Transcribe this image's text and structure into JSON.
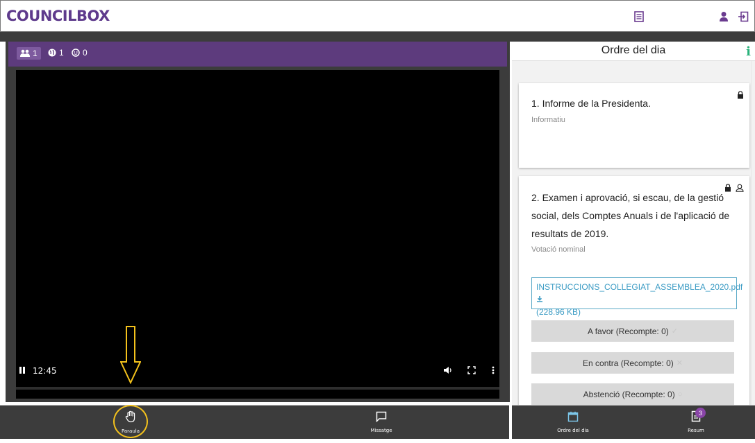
{
  "app": {
    "logo": "COUNCILBOX",
    "icons": [
      "list-icon",
      "user-icon",
      "logout-icon"
    ]
  },
  "video_header": {
    "participants_count": "1",
    "online_count": "1",
    "viewers_count": "0"
  },
  "video": {
    "time": "12:45"
  },
  "agenda": {
    "title": "Ordre del dia",
    "items": [
      {
        "title": "1. Informe de la Presidenta.",
        "type": "Informatiu"
      },
      {
        "title": "2. Examen i aprovació, si escau, de la gestió social, dels Comptes Anuals i de l'aplicació de resultats de 2019.",
        "type": "Votació nominal",
        "attachment_name": "INSTRUCCIONS_COLLEGIAT_ASSEMBLEA_2020.pdf",
        "attachment_size": "(228.96 KB)",
        "votes": [
          {
            "label": "A favor (Recompte: 0)",
            "icon": "check-icon"
          },
          {
            "label": "En contra (Recompte: 0)",
            "icon": "x-icon"
          },
          {
            "label": "Abstenció (Recompte: 0)",
            "icon": "circle-icon"
          }
        ]
      }
    ]
  },
  "bottom_bar": {
    "word_label": "Paraula",
    "message_label": "Missatge",
    "agenda_label": "Ordre del dia",
    "summary_label": "Resum",
    "summary_badge": "3"
  },
  "colors": {
    "brand": "#5e3a8c",
    "video_header": "#5d3b7d",
    "highlight": "#f4c21c",
    "info": "#2ab27b",
    "link": "#3a9bc4"
  }
}
